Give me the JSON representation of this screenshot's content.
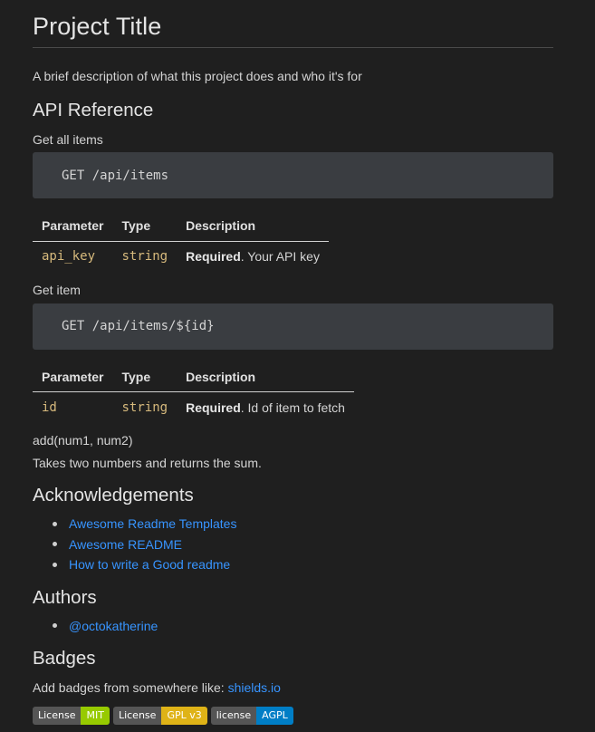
{
  "title": "Project Title",
  "description": "A brief description of what this project does and who it's for",
  "api_reference": {
    "heading": "API Reference",
    "get_all": {
      "label": "Get all items",
      "code": "GET /api/items",
      "table": {
        "headers": [
          "Parameter",
          "Type",
          "Description"
        ],
        "row": {
          "parameter": "api_key",
          "type": "string",
          "required": "Required",
          "rest": ". Your API key"
        }
      }
    },
    "get_item": {
      "label": "Get item",
      "code": "GET /api/items/${id}",
      "table": {
        "headers": [
          "Parameter",
          "Type",
          "Description"
        ],
        "row": {
          "parameter": "id",
          "type": "string",
          "required": "Required",
          "rest": ". Id of item to fetch"
        }
      }
    },
    "function_signature": "add(num1, num2)",
    "function_description": "Takes two numbers and returns the sum."
  },
  "acknowledgements": {
    "heading": "Acknowledgements",
    "links": [
      "Awesome Readme Templates",
      "Awesome README",
      "How to write a Good readme"
    ]
  },
  "authors": {
    "heading": "Authors",
    "links": [
      "@octokatherine"
    ]
  },
  "badges": {
    "heading": "Badges",
    "intro": "Add badges from somewhere like: ",
    "intro_link": "shields.io",
    "items": [
      {
        "label": "License",
        "value": "MIT",
        "color": "#97ca00"
      },
      {
        "label": "License",
        "value": "GPL v3",
        "color": "#dfb317"
      },
      {
        "label": "license",
        "value": "AGPL",
        "color": "#007ec6"
      }
    ]
  },
  "colors": {
    "background": "#1f1f1f",
    "link": "#3794ff",
    "code_block": "#3a3d41",
    "code_accent": "#d7ba7d"
  }
}
